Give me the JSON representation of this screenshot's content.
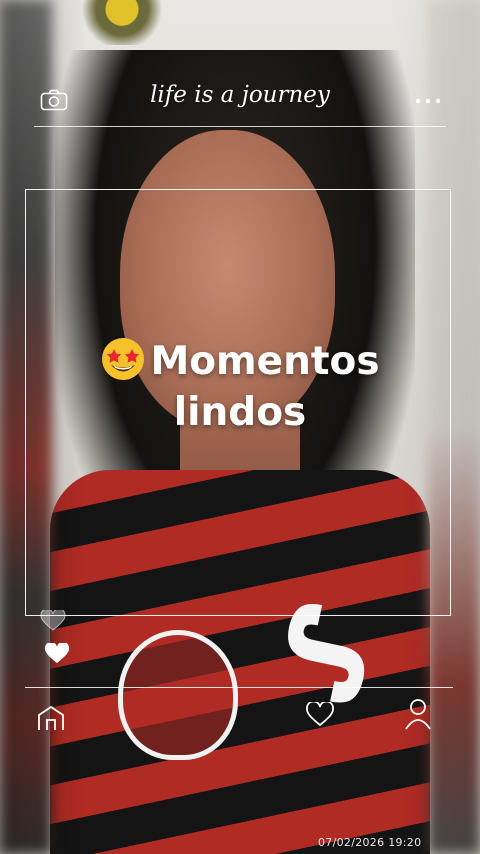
{
  "header": {
    "tagline": "life is a journey",
    "camera_icon": "camera-icon",
    "more_icon": "more-horizontal-icon"
  },
  "caption": {
    "line1": "Momentos",
    "line2": "lindos",
    "emoji": "star-struck-emoji"
  },
  "side_icons": [
    "heart-outline-icon",
    "heart-filled-icon"
  ],
  "bottom_bar": {
    "icons": [
      "home-icon",
      "heart-outline-icon",
      "profile-icon"
    ]
  },
  "timestamp": "07/02/2026  19:20",
  "colors": {
    "overlay": "#ffffff",
    "jersey_red": "#b02b24",
    "jersey_black": "#141414"
  }
}
